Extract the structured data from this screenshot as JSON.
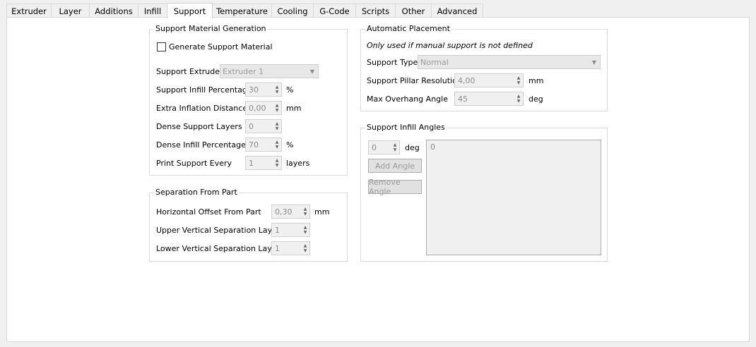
{
  "tabs": [
    "Extruder",
    "Layer",
    "Additions",
    "Infill",
    "Support",
    "Temperature",
    "Cooling",
    "G-Code",
    "Scripts",
    "Other",
    "Advanced"
  ],
  "active_tab": "Support",
  "support_generation": {
    "title": "Support Material Generation",
    "generate_label": "Generate Support Material",
    "generate_checked": false,
    "extruder_label": "Support Extruder",
    "extruder_value": "Extruder 1",
    "infill_pct_label": "Support Infill Percentage",
    "infill_pct_value": "30",
    "infill_pct_unit": "%",
    "inflation_label": "Extra Inflation Distance",
    "inflation_value": "0,00",
    "inflation_unit": "mm",
    "dense_layers_label": "Dense Support Layers",
    "dense_layers_value": "0",
    "dense_infill_label": "Dense Infill Percentage",
    "dense_infill_value": "70",
    "dense_infill_unit": "%",
    "print_every_label": "Print Support Every",
    "print_every_value": "1",
    "print_every_unit": "layers"
  },
  "separation": {
    "title": "Separation From Part",
    "horizontal_label": "Horizontal Offset From Part",
    "horizontal_value": "0,30",
    "horizontal_unit": "mm",
    "upper_label": "Upper Vertical Separation Layers",
    "upper_value": "1",
    "lower_label": "Lower Vertical Separation Layers",
    "lower_value": "1"
  },
  "automatic": {
    "title": "Automatic Placement",
    "note": "Only used if manual support is not defined",
    "type_label": "Support Type",
    "type_value": "Normal",
    "pillar_label": "Support Pillar Resolution",
    "pillar_value": "4,00",
    "pillar_unit": "mm",
    "overhang_label": "Max Overhang Angle",
    "overhang_value": "45",
    "overhang_unit": "deg"
  },
  "angles": {
    "title": "Support Infill Angles",
    "angle_value": "0",
    "angle_unit": "deg",
    "add_label": "Add Angle",
    "remove_label": "Remove Angle",
    "list_items": [
      "0"
    ]
  },
  "icons": {
    "spin_up": "▲",
    "spin_down": "▼",
    "dropdown": "▼"
  }
}
